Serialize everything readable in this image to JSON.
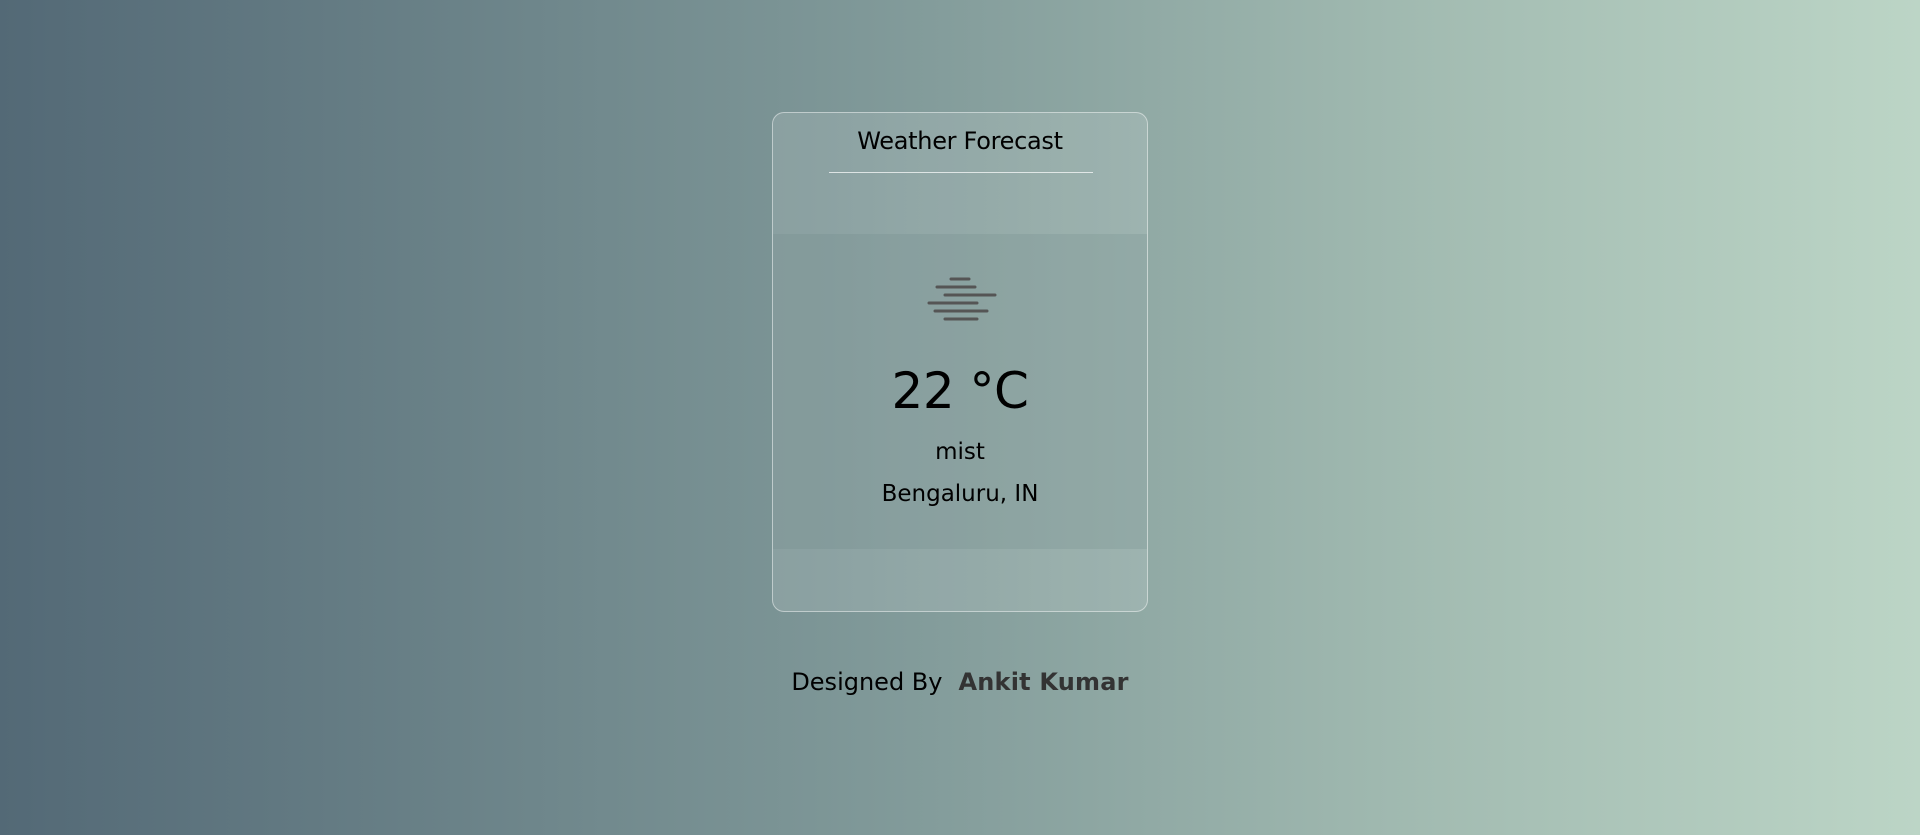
{
  "card": {
    "title": "Weather Forecast"
  },
  "weather": {
    "icon": "mist-icon",
    "temperature": "22 °C",
    "condition": "mist",
    "location": "Bengaluru, IN"
  },
  "footer": {
    "designed_by_label": "Designed By",
    "author": "Ankit Kumar"
  },
  "colors": {
    "background_start": "#536976",
    "background_end": "#bcd5c6",
    "icon": "#555555",
    "author": "#333333"
  }
}
